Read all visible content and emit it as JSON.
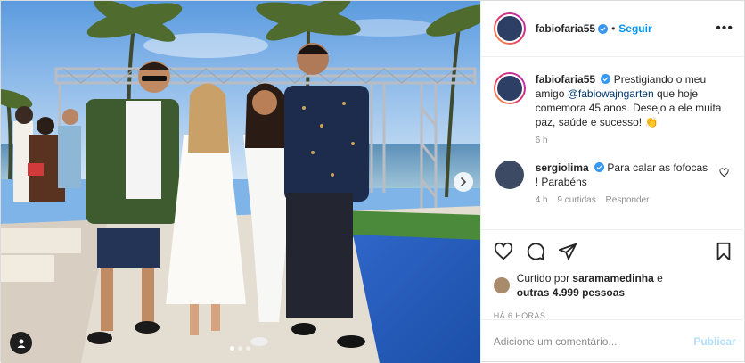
{
  "post": {
    "username": "fabiofaria55",
    "follow_label": "Seguir",
    "separator": "•",
    "more_icon": "more-options-icon"
  },
  "caption": {
    "username": "fabiofaria55",
    "text_before": "Prestigiando o meu amigo ",
    "mention": "@fabiowajngarten",
    "text_after": " que hoje comemora 45 anos. Desejo a ele muita paz, saúde e sucesso! ",
    "emoji": "👏",
    "time": "6 h"
  },
  "comment": {
    "username": "sergiolima",
    "text": "Para calar as fofocas ! Parabéns",
    "time": "4 h",
    "likes": "9 curtidas",
    "reply_label": "Responder"
  },
  "likes": {
    "prefix": "Curtido por ",
    "user": "saramamedinha",
    "middle": " e",
    "others": "outras 4.999 pessoas"
  },
  "timestamp": "HÁ 6 HORAS",
  "composer": {
    "placeholder": "Adicione um comentário...",
    "publish_label": "Publicar"
  },
  "carousel": {
    "total": 3,
    "active": 1
  },
  "colors": {
    "link": "#0095f6",
    "mention": "#00376b",
    "verified": "#3897f0",
    "muted": "#8e8e8e"
  }
}
